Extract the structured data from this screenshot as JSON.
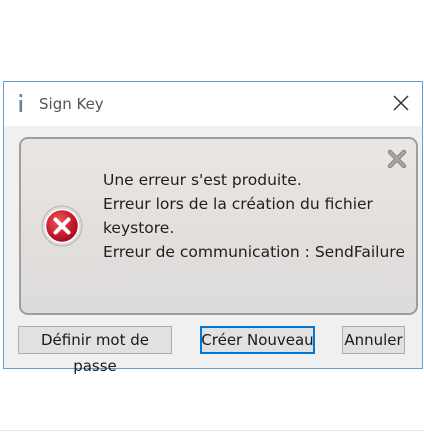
{
  "window": {
    "title": "Sign Key",
    "title_icon": "info-icon",
    "close_icon": "close-icon"
  },
  "message": {
    "icon": "error-icon",
    "lines": [
      "Une erreur s'est produite.",
      "Erreur lors de la création du fichier",
      "keystore.",
      "Erreur de communication : SendFailure"
    ]
  },
  "buttons": {
    "set_password": "Définir mot de passe",
    "create_new": "Créer Nouveau",
    "cancel": "Annuler"
  },
  "colors": {
    "accent": "#0078d7",
    "error": "#c4172c",
    "window_border": "#6c9bd0"
  }
}
